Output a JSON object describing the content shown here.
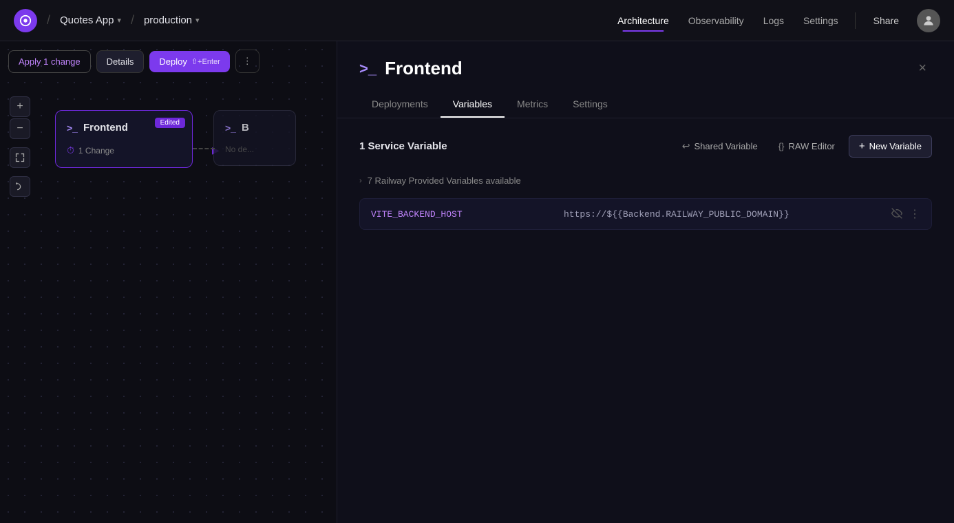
{
  "app": {
    "title": "Quotes App",
    "env": "production",
    "logo_symbol": "◎"
  },
  "nav": {
    "architecture_label": "Architecture",
    "observability_label": "Observability",
    "logs_label": "Logs",
    "settings_label": "Settings",
    "share_label": "Share",
    "active_tab": "Architecture"
  },
  "canvas": {
    "apply_change_label": "Apply 1 change",
    "details_label": "Details",
    "deploy_label": "Deploy",
    "deploy_shortcut": "⇧+Enter",
    "more_icon": "⋮",
    "plus_icon": "+",
    "minus_icon": "−",
    "expand_icon": "⛶",
    "undo_icon": "↩"
  },
  "frontend_card": {
    "title": "Frontend",
    "icon": ">_",
    "edited_badge": "Edited",
    "change_label": "1 Change",
    "change_icon": "⏱"
  },
  "backend_card": {
    "title": "B",
    "icon": ">_",
    "no_data": "No de..."
  },
  "panel": {
    "title": "Frontend",
    "title_icon": ">_",
    "close_icon": "×",
    "tabs": [
      {
        "label": "Deployments",
        "active": false
      },
      {
        "label": "Variables",
        "active": true
      },
      {
        "label": "Metrics",
        "active": false
      },
      {
        "label": "Settings",
        "active": false
      }
    ],
    "vars_section_title": "1 Service Variable",
    "shared_variable_label": "Shared Variable",
    "raw_editor_label": "RAW Editor",
    "new_variable_label": "New Variable",
    "new_variable_icon": "+",
    "shared_var_icon": "↩",
    "raw_editor_icon": "{}",
    "railway_vars_label": "7 Railway Provided Variables available",
    "variable": {
      "key": "VITE_BACKEND_HOST",
      "value": "https://${{Backend.RAILWAY_PUBLIC_DOMAIN}}"
    }
  }
}
